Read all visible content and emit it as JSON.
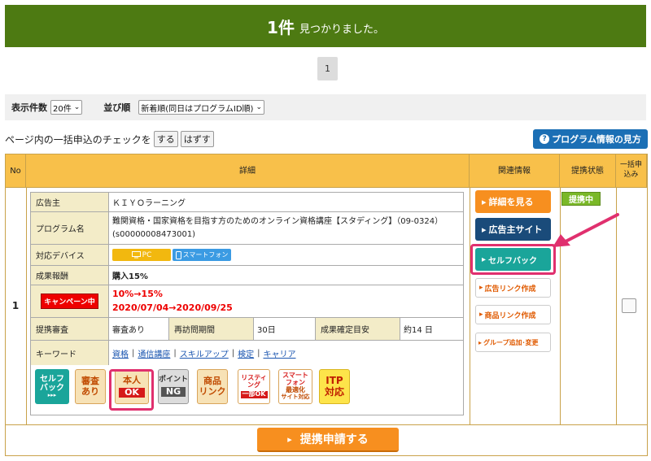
{
  "banner": {
    "count": "1件",
    "message": "見つかりました。"
  },
  "pager": {
    "current_page": "1"
  },
  "filters": {
    "per_page_label": "表示件数",
    "per_page_value": "20件",
    "sort_label": "並び順",
    "sort_value": "新着順(同日はプログラムID順)"
  },
  "bulk": {
    "text": "ページ内の一括申込のチェックを",
    "on_label": "する",
    "off_label": "はずす"
  },
  "help_button": {
    "label": "プログラム情報の見方"
  },
  "table": {
    "headers": [
      "No",
      "詳細",
      "関連情報",
      "提携状態",
      "一括申込み"
    ],
    "row_no": "1",
    "details": {
      "advertiser_label": "広告主",
      "advertiser_value": "ＫＩＹＯラーニング",
      "program_label": "プログラム名",
      "program_value": "難関資格・国家資格を目指す方のためのオンライン資格講座【スタディング】（09-0324）(s00000008473001)",
      "device_label": "対応デバイス",
      "device_pc": "PC",
      "device_sp": "スマートフォン",
      "reward_label": "成果報酬",
      "reward_value": "購入15%",
      "campaign_badge": "キャンペーン中",
      "campaign_line1": "10%→15%",
      "campaign_line2": "2020/07/04→2020/09/25",
      "review_label": "提携審査",
      "review_value": "審査あり",
      "revisit_label": "再訪問期間",
      "revisit_value": "30日",
      "confirm_label": "成果確定目安",
      "confirm_value": "約14 日",
      "keyword_label": "キーワード",
      "keywords": [
        "資格",
        "通信講座",
        "スキルアップ",
        "検定",
        "キャリア"
      ],
      "keyword_sep": "|"
    },
    "badges": {
      "self_back": [
        "セルフ",
        "バック",
        "▸▸▸"
      ],
      "review": [
        "審査",
        "あり"
      ],
      "self_ok": [
        "本人",
        "OK"
      ],
      "point_ng": [
        "ポイント",
        "NG"
      ],
      "product_link": [
        "商品",
        "リンク"
      ],
      "listing": [
        "リスティ",
        "ング",
        "一部OK"
      ],
      "smartphone": [
        "スマート",
        "フォン",
        "最適化",
        "サイト対応"
      ],
      "itp": [
        "ITP",
        "対応"
      ]
    },
    "related": {
      "details_btn": "詳細を見る",
      "advertiser_site_btn": "広告主サイト",
      "self_back_btn": "セルフバック",
      "ad_link_btn": "広告リンク作成",
      "product_link_btn": "商品リンク作成",
      "group_btn": "グループ追加･変更"
    },
    "status": "提携中",
    "apply_button": "提携申請する"
  },
  "colors": {
    "banner": "#4d7a12",
    "header": "#f8c04a",
    "orange": "#f78f1f",
    "navy": "#1a4b7a",
    "teal": "#1aa59a",
    "highlight": "#e0306e"
  }
}
